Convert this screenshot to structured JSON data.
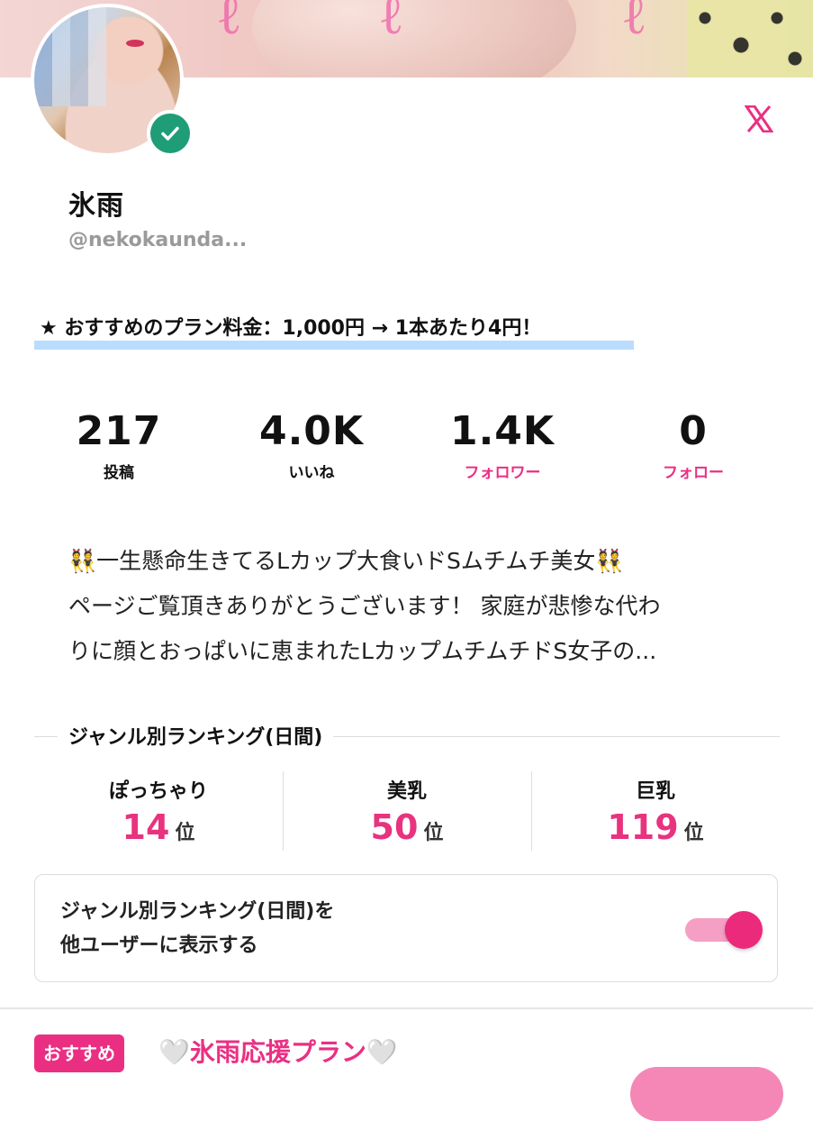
{
  "profile": {
    "name": "氷雨",
    "handle": "@nekokaunda...",
    "plan_note": "おすすめのプラン料金：1,000円 → 1本あたり4円！"
  },
  "stats": [
    {
      "value": "217",
      "label": "投稿",
      "link": false
    },
    {
      "value": "4.0K",
      "label": "いいね",
      "link": false
    },
    {
      "value": "1.4K",
      "label": "フォロワー",
      "link": true
    },
    {
      "value": "0",
      "label": "フォロー",
      "link": true
    }
  ],
  "bio": {
    "lines": [
      "👯一生懸命生きてるLカップ大食いドSムチムチ美女👯",
      "ページご覧頂きありがとうございます！ 家庭が悲惨な代わ",
      "りに顔とおっぱいに恵まれたLカップムチムチドS女子の..."
    ]
  },
  "ranking": {
    "title": "ジャンル別ランキング(日間)",
    "unit": "位",
    "items": [
      {
        "category": "ぽっちゃり",
        "rank": "14"
      },
      {
        "category": "美乳",
        "rank": "50"
      },
      {
        "category": "巨乳",
        "rank": "119"
      }
    ]
  },
  "toggle": {
    "line1": "ジャンル別ランキング(日間)を",
    "line2": "他ユーザーに表示する",
    "state": "on"
  },
  "plan": {
    "badge": "おすすめ",
    "heart": "🤍",
    "title": "氷雨応援プラン"
  },
  "colors": {
    "accent": "#ea2f83",
    "verified": "#1f9d77",
    "highlight": "#b9dcff"
  },
  "icons": {
    "verified": "check-badge-icon",
    "social": "x-logo-icon",
    "star": "star-icon"
  }
}
